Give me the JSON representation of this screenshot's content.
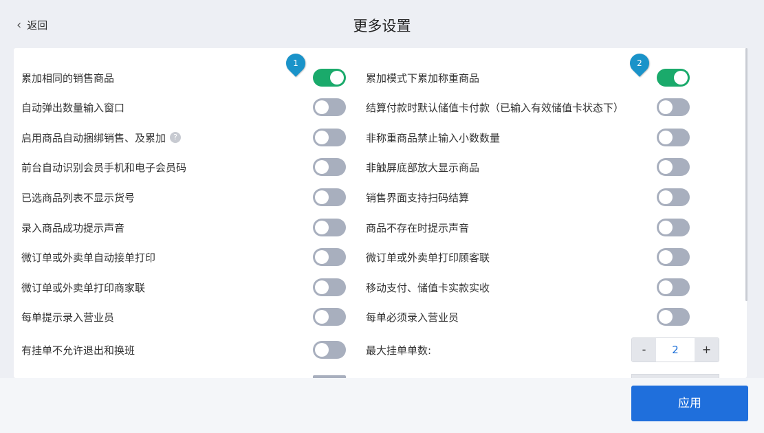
{
  "header": {
    "back_label": "返回",
    "title": "更多设置"
  },
  "left_settings": [
    {
      "label": "累加相同的销售商品",
      "on": true
    },
    {
      "label": "自动弹出数量输入窗口",
      "on": false
    },
    {
      "label": "启用商品自动捆绑销售、及累加",
      "on": false,
      "help": "?"
    },
    {
      "label": "前台自动识别会员手机和电子会员码",
      "on": false
    },
    {
      "label": "已选商品列表不显示货号",
      "on": false
    },
    {
      "label": "录入商品成功提示声音",
      "on": false
    },
    {
      "label": "微订单或外卖单自动接单打印",
      "on": false
    },
    {
      "label": "微订单或外卖单打印商家联",
      "on": false
    },
    {
      "label": "每单提示录入营业员",
      "on": false
    },
    {
      "label": "有挂单不允许退出和换班",
      "on": false
    }
  ],
  "right_settings": [
    {
      "label": "累加模式下累加称重商品",
      "on": true
    },
    {
      "label": "结算付款时默认储值卡付款（已输入有效储值卡状态下）",
      "on": false
    },
    {
      "label": "非称重商品禁止输入小数数量",
      "on": false
    },
    {
      "label": "非触屏底部放大显示商品",
      "on": false
    },
    {
      "label": "销售界面支持扫码结算",
      "on": false
    },
    {
      "label": "商品不存在时提示声音",
      "on": false
    },
    {
      "label": "微订单或外卖单打印顾客联",
      "on": false
    },
    {
      "label": "移动支付、储值卡实款实收",
      "on": false
    },
    {
      "label": "每单必须录入营业员",
      "on": false
    }
  ],
  "max_hold": {
    "label": "最大挂单单数:",
    "minus": "-",
    "value": "2",
    "plus": "+"
  },
  "markers": [
    "1",
    "2"
  ],
  "footer": {
    "apply_label": "应用"
  },
  "colors": {
    "toggle_on": "#1aaa6b",
    "toggle_off": "#a8afbe",
    "accent": "#1f6fdc",
    "marker": "#1a93c9"
  }
}
